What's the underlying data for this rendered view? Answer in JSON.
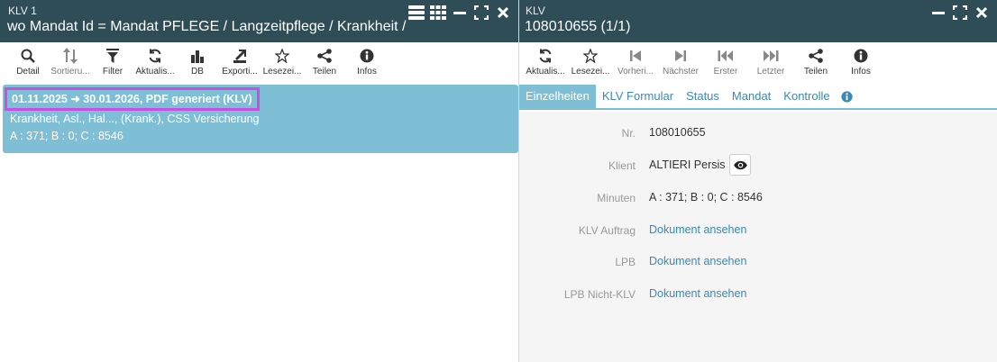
{
  "left": {
    "module": "KLV 1",
    "title": "wo Mandat Id = Mandat PFLEGE / Langzeitpflege / Krankheit /",
    "toolbar": [
      {
        "label": "Detail",
        "icon": "search-icon"
      },
      {
        "label": "Sortieru...",
        "icon": "sort-icon"
      },
      {
        "label": "Filter",
        "icon": "filter-icon"
      },
      {
        "label": "Aktualis...",
        "icon": "refresh-icon"
      },
      {
        "label": "DB",
        "icon": "bar-chart-icon"
      },
      {
        "label": "Exporti...",
        "icon": "export-icon"
      },
      {
        "label": "Lesezei...",
        "icon": "star-icon"
      },
      {
        "label": "Teilen",
        "icon": "share-icon"
      },
      {
        "label": "Infos",
        "icon": "info-icon"
      }
    ],
    "item": {
      "header": "01.11.2025 ➜ 30.01.2026, PDF generiert (KLV)",
      "subtitle": "Krankheit, Asl., Hal..., (Krank.), CSS Versicherung",
      "numbers": "A : 371; B : 0; C : 8546"
    }
  },
  "right": {
    "module": "KLV",
    "title": "108010655 (1/1)",
    "toolbar": [
      {
        "label": "Aktualis...",
        "icon": "refresh-icon"
      },
      {
        "label": "Lesezei...",
        "icon": "star-icon"
      },
      {
        "label": "Vorheri...",
        "icon": "previous-icon"
      },
      {
        "label": "Nächster",
        "icon": "next-icon"
      },
      {
        "label": "Erster",
        "icon": "first-icon"
      },
      {
        "label": "Letzter",
        "icon": "last-icon"
      },
      {
        "label": "Teilen",
        "icon": "share-icon"
      },
      {
        "label": "Infos",
        "icon": "info-icon"
      }
    ],
    "tabs": [
      "Einzelheiten",
      "KLV Formular",
      "Status",
      "Mandat",
      "Kontrolle"
    ],
    "details": {
      "nr_label": "Nr.",
      "nr_value": "108010655",
      "klient_label": "Klient",
      "klient_value": "ALTIERI Persis",
      "minuten_label": "Minuten",
      "minuten_value": "A : 371; B : 0; C : 8546",
      "auftrag_label": "KLV Auftrag",
      "auftrag_value": "Dokument ansehen",
      "lpb_label": "LPB",
      "lpb_value": "Dokument ansehen",
      "lpbn_label": "LPB Nicht-KLV",
      "lpbn_value": "Dokument ansehen"
    }
  },
  "colors": {
    "titlebar": "#2f4d57",
    "accent": "#7ebfd6",
    "link": "#3b88b3",
    "highlight": "#c84fe0"
  }
}
